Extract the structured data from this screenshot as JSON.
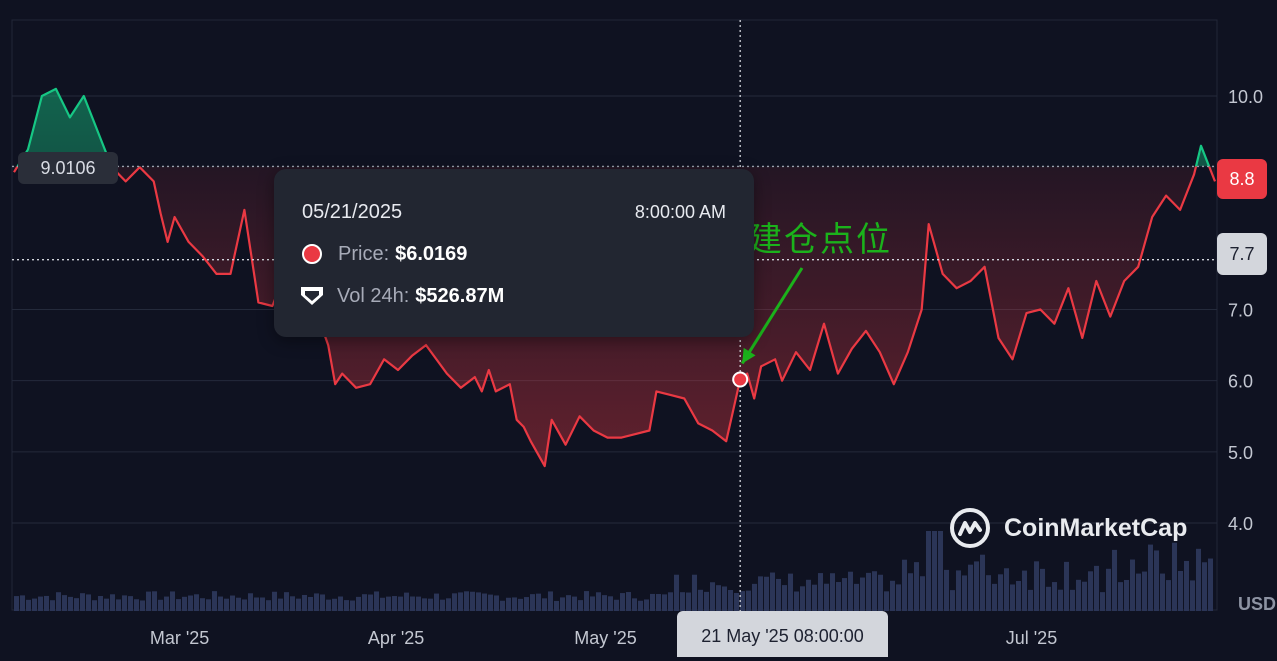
{
  "chart_data": {
    "type": "line",
    "baseline_price": 9.0106,
    "y_ticks": [
      "10.0",
      "7.0",
      "6.0",
      "5.0",
      "4.0"
    ],
    "x_ticks": [
      "Mar '25",
      "Apr '25",
      "May '25",
      "Jul '25"
    ],
    "ylim": [
      3.3,
      11.3
    ],
    "price_series": [
      [
        "2025-02-06",
        8.93
      ],
      [
        "2025-02-08",
        9.25
      ],
      [
        "2025-02-10",
        10.0
      ],
      [
        "2025-02-12",
        10.1
      ],
      [
        "2025-02-14",
        9.7
      ],
      [
        "2025-02-16",
        10.0
      ],
      [
        "2025-02-18",
        9.5
      ],
      [
        "2025-02-20",
        9.0
      ],
      [
        "2025-02-22",
        8.8
      ],
      [
        "2025-02-24",
        9.0
      ],
      [
        "2025-02-26",
        8.8
      ],
      [
        "2025-02-27",
        8.35
      ],
      [
        "2025-02-28",
        7.95
      ],
      [
        "2025-03-01",
        8.3
      ],
      [
        "2025-03-03",
        7.95
      ],
      [
        "2025-03-05",
        7.75
      ],
      [
        "2025-03-07",
        7.5
      ],
      [
        "2025-03-09",
        7.5
      ],
      [
        "2025-03-11",
        8.4
      ],
      [
        "2025-03-13",
        7.1
      ],
      [
        "2025-03-15",
        7.05
      ],
      [
        "2025-03-17",
        7.55
      ],
      [
        "2025-03-19",
        7.05
      ],
      [
        "2025-03-21",
        7.05
      ],
      [
        "2025-03-23",
        6.5
      ],
      [
        "2025-03-24",
        5.95
      ],
      [
        "2025-03-25",
        6.1
      ],
      [
        "2025-03-27",
        5.9
      ],
      [
        "2025-03-29",
        5.95
      ],
      [
        "2025-03-31",
        6.3
      ],
      [
        "2025-04-02",
        6.15
      ],
      [
        "2025-04-04",
        6.35
      ],
      [
        "2025-04-06",
        6.5
      ],
      [
        "2025-04-09",
        6.1
      ],
      [
        "2025-04-11",
        5.9
      ],
      [
        "2025-04-13",
        6.05
      ],
      [
        "2025-04-14",
        5.85
      ],
      [
        "2025-04-15",
        6.15
      ],
      [
        "2025-04-16",
        5.85
      ],
      [
        "2025-04-18",
        5.95
      ],
      [
        "2025-04-19",
        5.45
      ],
      [
        "2025-04-20",
        5.35
      ],
      [
        "2025-04-21",
        5.15
      ],
      [
        "2025-04-23",
        4.8
      ],
      [
        "2025-04-24",
        5.45
      ],
      [
        "2025-04-26",
        5.1
      ],
      [
        "2025-04-28",
        5.5
      ],
      [
        "2025-04-30",
        5.3
      ],
      [
        "2025-05-02",
        5.2
      ],
      [
        "2025-05-04",
        5.2
      ],
      [
        "2025-05-06",
        5.25
      ],
      [
        "2025-05-08",
        5.3
      ],
      [
        "2025-05-09",
        5.85
      ],
      [
        "2025-05-11",
        5.8
      ],
      [
        "2025-05-13",
        5.75
      ],
      [
        "2025-05-15",
        5.4
      ],
      [
        "2025-05-17",
        5.3
      ],
      [
        "2025-05-19",
        5.15
      ],
      [
        "2025-05-21",
        6.02
      ],
      [
        "2025-05-22",
        6.1
      ],
      [
        "2025-05-23",
        5.75
      ],
      [
        "2025-05-24",
        6.2
      ],
      [
        "2025-05-26",
        6.3
      ],
      [
        "2025-05-27",
        6.0
      ],
      [
        "2025-05-29",
        6.4
      ],
      [
        "2025-05-31",
        6.15
      ],
      [
        "2025-06-02",
        6.8
      ],
      [
        "2025-06-04",
        6.1
      ],
      [
        "2025-06-06",
        6.45
      ],
      [
        "2025-06-08",
        6.7
      ],
      [
        "2025-06-10",
        6.4
      ],
      [
        "2025-06-12",
        5.95
      ],
      [
        "2025-06-14",
        6.4
      ],
      [
        "2025-06-16",
        7.0
      ],
      [
        "2025-06-17",
        8.2
      ],
      [
        "2025-06-19",
        7.5
      ],
      [
        "2025-06-21",
        7.3
      ],
      [
        "2025-06-23",
        7.4
      ],
      [
        "2025-06-25",
        7.6
      ],
      [
        "2025-06-27",
        6.6
      ],
      [
        "2025-06-29",
        6.3
      ],
      [
        "2025-07-01",
        6.95
      ],
      [
        "2025-07-03",
        7.0
      ],
      [
        "2025-07-05",
        6.8
      ],
      [
        "2025-07-07",
        7.3
      ],
      [
        "2025-07-09",
        6.6
      ],
      [
        "2025-07-11",
        7.4
      ],
      [
        "2025-07-13",
        6.9
      ],
      [
        "2025-07-15",
        7.4
      ],
      [
        "2025-07-17",
        7.6
      ],
      [
        "2025-07-19",
        8.3
      ],
      [
        "2025-07-21",
        8.6
      ],
      [
        "2025-07-23",
        8.4
      ],
      [
        "2025-07-25",
        8.9
      ],
      [
        "2025-07-26",
        9.3
      ],
      [
        "2025-07-28",
        8.8
      ]
    ]
  },
  "tooltip": {
    "date": "05/21/2025",
    "time": "8:00:00 AM",
    "price_label": "Price:",
    "price_value": "$6.0169",
    "vol_label": "Vol 24h:",
    "vol_value": "$526.87M"
  },
  "badges": {
    "baseline": "9.0106",
    "current_price": "8.8",
    "crosshair_price": "7.7",
    "crosshair_date": "21 May '25 08:00:00"
  },
  "annotation": "建仓点位",
  "logo_text": "CoinMarketCap",
  "currency": "USD",
  "colors": {
    "up": "#16c784",
    "down": "#ea3943",
    "annotation": "#1bb21b",
    "volume": "#2b3557"
  }
}
